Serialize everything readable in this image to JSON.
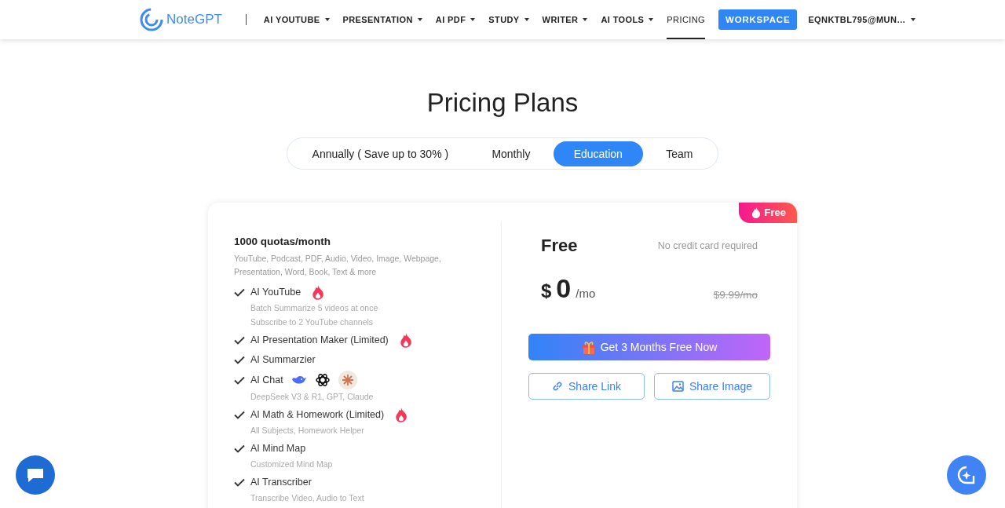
{
  "nav": {
    "brand": "NoteGPT",
    "items": [
      {
        "label": "AI YOUTUBE",
        "dropdown": true,
        "selected": false
      },
      {
        "label": "PRESENTATION",
        "dropdown": true,
        "selected": false
      },
      {
        "label": "AI PDF",
        "dropdown": true,
        "selected": false
      },
      {
        "label": "STUDY",
        "dropdown": true,
        "selected": false
      },
      {
        "label": "WRITER",
        "dropdown": true,
        "selected": false
      },
      {
        "label": "AI TOOLS",
        "dropdown": true,
        "selected": false
      },
      {
        "label": "PRICING",
        "dropdown": false,
        "selected": true
      }
    ],
    "workspace": "WORKSPACE",
    "account": "EQNKTBL795@MUN…"
  },
  "title": "Pricing Plans",
  "tabs": [
    {
      "label": "Annually ( Save up to 30% )",
      "selected": false
    },
    {
      "label": "Monthly",
      "selected": false
    },
    {
      "label": "Education",
      "selected": true
    },
    {
      "label": "Team",
      "selected": false
    }
  ],
  "plan": {
    "ribbon": "Free",
    "quota": "1000 quotas/month",
    "quota_note": "YouTube, Podcast, PDF, Audio, Video, Image, Webpage, Presentation, Word, Book, Text & more",
    "features": [
      {
        "name": "AI YouTube",
        "kind": "hot",
        "notes": [
          "Batch Summarize 5 videos at once",
          "Subscribe to 2 YouTube channels"
        ]
      },
      {
        "name": "AI Presentation Maker (Limited)",
        "kind": "hot"
      },
      {
        "name": "AI Summarzier",
        "kind": "plain"
      },
      {
        "name": "AI Chat",
        "kind": "models",
        "notes": [
          "DeepSeek V3 & R1, GPT, Claude"
        ]
      },
      {
        "name": "AI Math & Homework (Limited)",
        "kind": "hot",
        "notes": [
          "All Subjects, Homework Helper"
        ]
      },
      {
        "name": "AI Mind Map",
        "kind": "plain",
        "notes": [
          "Customized Mind Map"
        ]
      },
      {
        "name": "AI Transcriber",
        "kind": "plain",
        "notes": [
          "Transcribe Video, Audio to Text"
        ]
      }
    ],
    "name": "Free",
    "no_card": "No credit card required",
    "currency": "$",
    "price": "0",
    "period": "/mo",
    "old_price": "$9.99/mo",
    "cta": "Get 3 Months Free Now",
    "share_link": "Share Link",
    "share_image": "Share Image"
  }
}
